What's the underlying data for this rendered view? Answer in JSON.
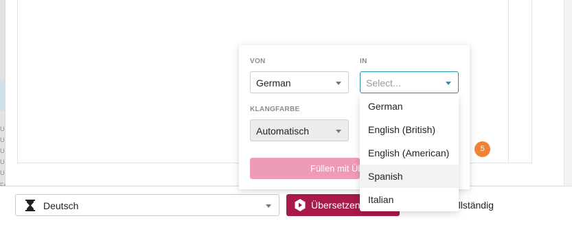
{
  "popover": {
    "source": {
      "label": "VON",
      "value": "German"
    },
    "target": {
      "label": "IN",
      "placeholder": "Select..."
    },
    "voice": {
      "label": "KLANGFARBE",
      "value": "Automatisch"
    },
    "fill_button": "Füllen mit Üb"
  },
  "dropdown": {
    "options": [
      "German",
      "English (British)",
      "English (American)",
      "Spanish",
      "Italian"
    ],
    "highlighted": "Spanish"
  },
  "badge_count": "5",
  "bottom_bar": {
    "language": "Deutsch",
    "translate_button": "Übersetzen m",
    "status_text": "isierung ist vollständig"
  },
  "left_fragments": [
    "U",
    "U",
    "U",
    "U",
    "U",
    "Fe",
    "Y",
    "V"
  ],
  "colors": {
    "brand": "#a8194c",
    "fill_button": "#ee9bb6",
    "badge": "#f08332",
    "focus": "#2c8fba"
  }
}
